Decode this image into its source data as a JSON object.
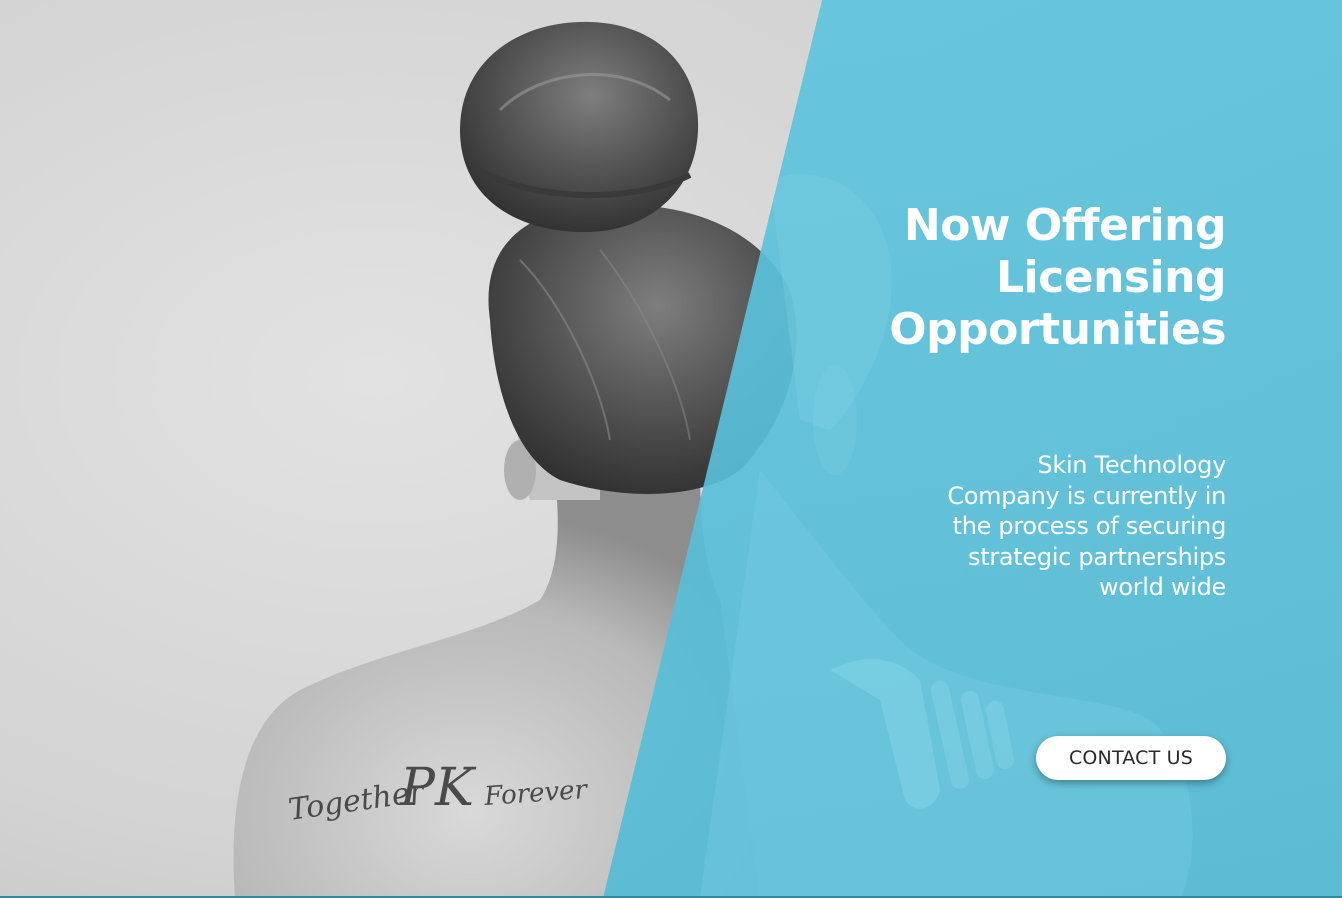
{
  "hero": {
    "headline_lines": [
      "Now Offering",
      "Licensing",
      "Opportunities"
    ],
    "description_lines": [
      "Skin Technology",
      "Company is currently in",
      "the process of securing",
      "strategic partnerships",
      "world wide"
    ],
    "contact_button_label": "CONTACT US",
    "tattoo_text": {
      "left": "Together",
      "center": "PK",
      "right": "Forever"
    }
  },
  "colors": {
    "accent_teal": "#5ec4dd",
    "headline_text": "#ffffff",
    "button_background": "#ffffff",
    "button_text": "#2a2a2a"
  }
}
